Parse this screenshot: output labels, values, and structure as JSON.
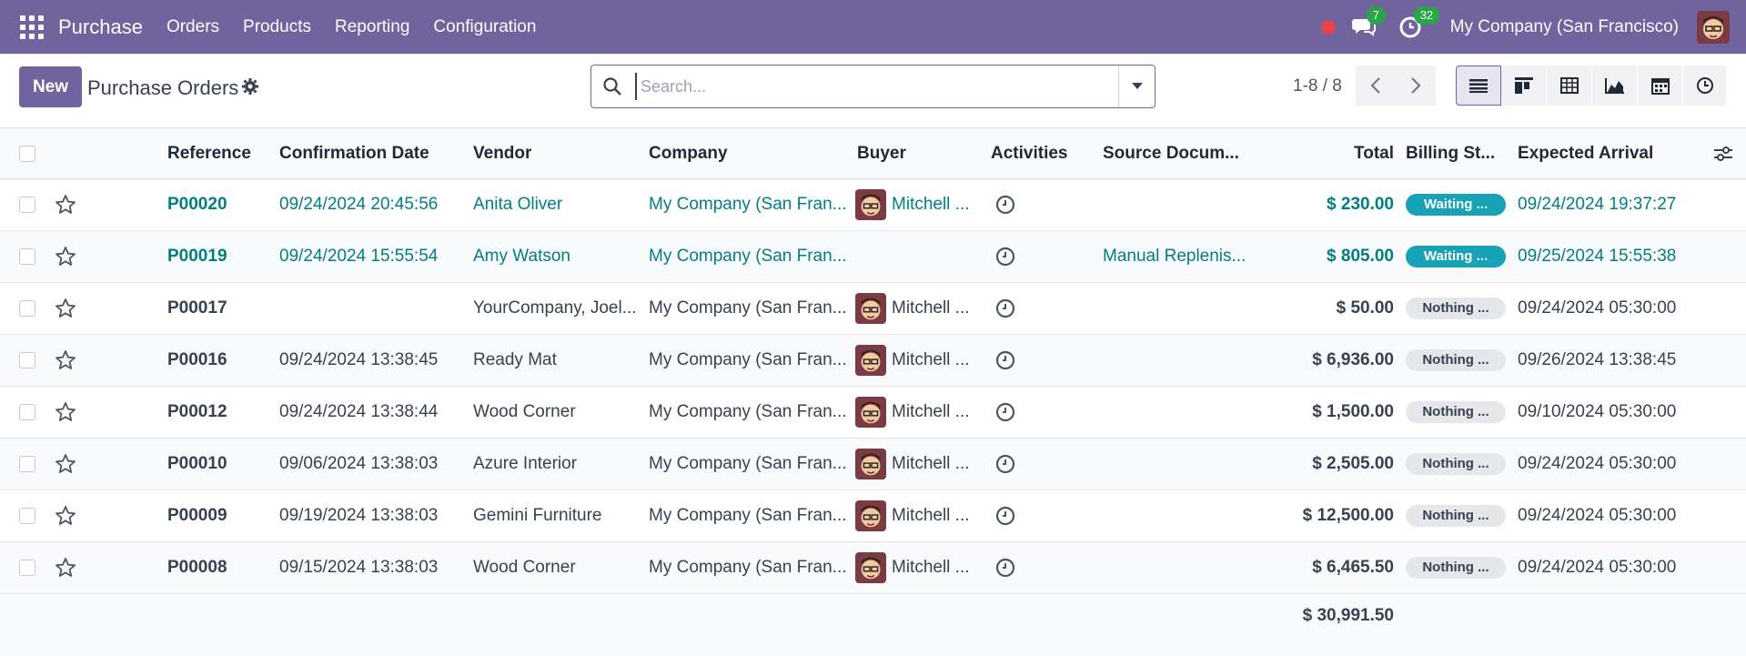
{
  "app": {
    "name": "Purchase",
    "menu": [
      "Orders",
      "Products",
      "Reporting",
      "Configuration"
    ],
    "messages_count": "7",
    "activities_count": "32",
    "company": "My Company (San Francisco)"
  },
  "control": {
    "new_label": "New",
    "title": "Purchase Orders",
    "search_placeholder": "Search...",
    "pager": "1-8 / 8"
  },
  "columns": {
    "reference": "Reference",
    "confirmation_date": "Confirmation Date",
    "vendor": "Vendor",
    "company": "Company",
    "buyer": "Buyer",
    "activities": "Activities",
    "source": "Source Docum...",
    "total": "Total",
    "billing": "Billing St...",
    "arrival": "Expected Arrival"
  },
  "rows": [
    {
      "ref": "P00020",
      "date": "09/24/2024 20:45:56",
      "vendor": "Anita Oliver",
      "company": "My Company (San Fran...",
      "buyer": "Mitchell ...",
      "source": "",
      "total": "$ 230.00",
      "billing": "Waiting ...",
      "arrival": "09/24/2024 19:37:27"
    },
    {
      "ref": "P00019",
      "date": "09/24/2024 15:55:54",
      "vendor": "Amy Watson",
      "company": "My Company (San Fran...",
      "buyer": "",
      "source": "Manual Replenis...",
      "total": "$ 805.00",
      "billing": "Waiting ...",
      "arrival": "09/25/2024 15:55:38"
    },
    {
      "ref": "P00017",
      "date": "",
      "vendor": "YourCompany, Joel...",
      "company": "My Company (San Fran...",
      "buyer": "Mitchell ...",
      "source": "",
      "total": "$ 50.00",
      "billing": "Nothing ...",
      "arrival": "09/24/2024 05:30:00"
    },
    {
      "ref": "P00016",
      "date": "09/24/2024 13:38:45",
      "vendor": "Ready Mat",
      "company": "My Company (San Fran...",
      "buyer": "Mitchell ...",
      "source": "",
      "total": "$ 6,936.00",
      "billing": "Nothing ...",
      "arrival": "09/26/2024 13:38:45"
    },
    {
      "ref": "P00012",
      "date": "09/24/2024 13:38:44",
      "vendor": "Wood Corner",
      "company": "My Company (San Fran...",
      "buyer": "Mitchell ...",
      "source": "",
      "total": "$ 1,500.00",
      "billing": "Nothing ...",
      "arrival": "09/10/2024 05:30:00"
    },
    {
      "ref": "P00010",
      "date": "09/06/2024 13:38:03",
      "vendor": "Azure Interior",
      "company": "My Company (San Fran...",
      "buyer": "Mitchell ...",
      "source": "",
      "total": "$ 2,505.00",
      "billing": "Nothing ...",
      "arrival": "09/24/2024 05:30:00"
    },
    {
      "ref": "P00009",
      "date": "09/19/2024 13:38:03",
      "vendor": "Gemini Furniture",
      "company": "My Company (San Fran...",
      "buyer": "Mitchell ...",
      "source": "",
      "total": "$ 12,500.00",
      "billing": "Nothing ...",
      "arrival": "09/24/2024 05:30:00"
    },
    {
      "ref": "P00008",
      "date": "09/15/2024 13:38:03",
      "vendor": "Wood Corner",
      "company": "My Company (San Fran...",
      "buyer": "Mitchell ...",
      "source": "",
      "total": "$ 6,465.50",
      "billing": "Nothing ...",
      "arrival": "09/24/2024 05:30:00"
    }
  ],
  "grand_total": "$ 30,991.50",
  "colors": {
    "brand": "#71639e",
    "link": "#017e84",
    "waiting": "#17a2b8",
    "badge": "#28a745",
    "record": "#e5464b"
  }
}
